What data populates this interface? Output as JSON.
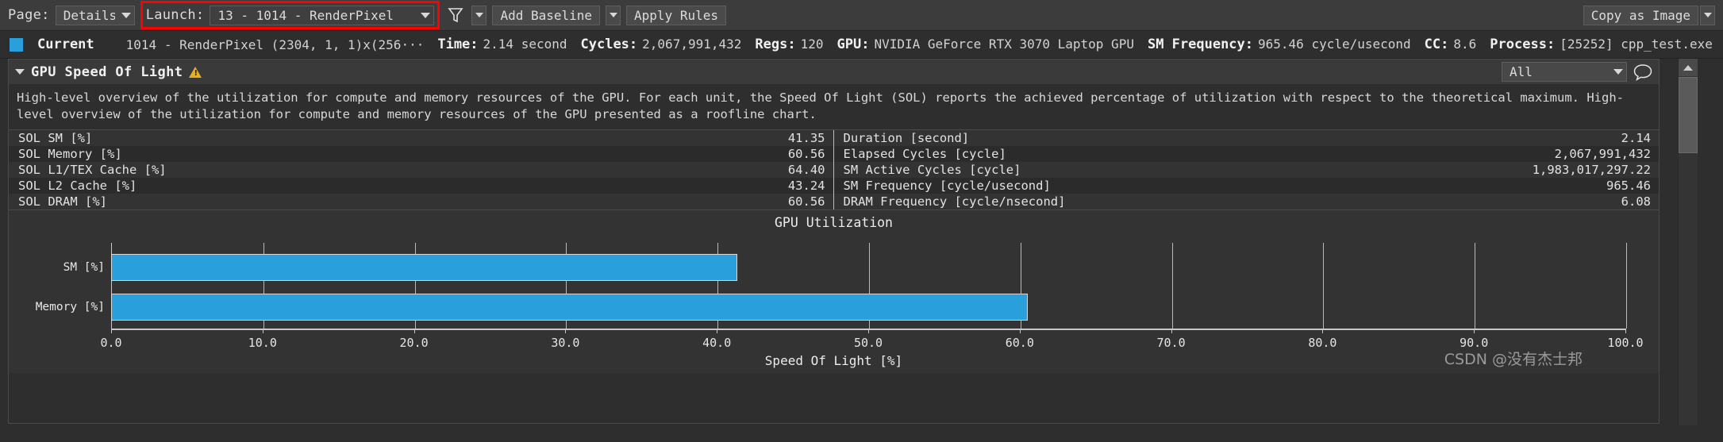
{
  "toolbar": {
    "page_label": "Page:",
    "page_value": "Details",
    "launch_label": "Launch:",
    "launch_value": "13 -  1014 - RenderPixel",
    "filter_icon": "funnel-icon",
    "add_baseline": "Add Baseline",
    "apply_rules": "Apply Rules",
    "copy_as_image": "Copy as Image",
    "highlight_color": "#ff0000"
  },
  "infobar": {
    "swatch_color": "#29a0dc",
    "current_label": "Current",
    "launch_desc": "1014 - RenderPixel (2304, 1, 1)x(256···",
    "time_key": "Time:",
    "time_value": "2.14 second",
    "cycles_key": "Cycles:",
    "cycles_value": "2,067,991,432",
    "regs_key": "Regs:",
    "regs_value": "120",
    "gpu_key": "GPU:",
    "gpu_value": "NVIDIA GeForce RTX 3070 Laptop GPU",
    "smfreq_key": "SM Frequency:",
    "smfreq_value": "965.46 cycle/usecond",
    "cc_key": "CC:",
    "cc_value": "8.6",
    "process_key": "Process:",
    "process_value": "[25252] cpp_test.exe",
    "zoom_in_icon": "plus-circle-icon",
    "zoom_out_icon": "minus-circle-icon",
    "info_icon": "info-circle-icon"
  },
  "section": {
    "collapse_icon": "chevron-down-icon",
    "title": "GPU Speed Of Light",
    "warning_icon": "warning-triangle-icon",
    "filter_value": "All",
    "comment_icon": "speech-bubble-icon",
    "description": "High-level overview of the utilization for compute and memory resources of the GPU. For each unit, the Speed Of Light (SOL) reports the achieved percentage of utilization with respect to the theoretical maximum. High-level overview of the utilization for compute and memory resources of the GPU presented as a roofline chart."
  },
  "metrics_left": [
    {
      "name": "SOL SM [%]",
      "value": "41.35"
    },
    {
      "name": "SOL Memory [%]",
      "value": "60.56"
    },
    {
      "name": "SOL L1/TEX Cache [%]",
      "value": "64.40"
    },
    {
      "name": "SOL L2 Cache [%]",
      "value": "43.24"
    },
    {
      "name": "SOL DRAM [%]",
      "value": "60.56"
    }
  ],
  "metrics_right": [
    {
      "name": "Duration [second]",
      "value": "2.14"
    },
    {
      "name": "Elapsed Cycles [cycle]",
      "value": "2,067,991,432"
    },
    {
      "name": "SM Active Cycles [cycle]",
      "value": "1,983,017,297.22"
    },
    {
      "name": "SM Frequency [cycle/usecond]",
      "value": "965.46"
    },
    {
      "name": "DRAM Frequency [cycle/nsecond]",
      "value": "6.08"
    }
  ],
  "chart_data": {
    "type": "bar",
    "orientation": "horizontal",
    "title": "GPU Utilization",
    "xlabel": "Speed Of Light [%]",
    "ylabel": "",
    "categories": [
      "SM [%]",
      "Memory [%]"
    ],
    "values": [
      41.35,
      60.56
    ],
    "xlim": [
      0.0,
      100.0
    ],
    "xticks": [
      0.0,
      10.0,
      20.0,
      30.0,
      40.0,
      50.0,
      60.0,
      70.0,
      80.0,
      90.0,
      100.0
    ],
    "xticklabels": [
      "0.0",
      "10.0",
      "20.0",
      "30.0",
      "40.0",
      "50.0",
      "60.0",
      "70.0",
      "80.0",
      "90.0",
      "100.0"
    ],
    "grid": true,
    "legend": false,
    "bar_color": "#29a0dc"
  },
  "watermark": "CSDN @没有杰士邦"
}
